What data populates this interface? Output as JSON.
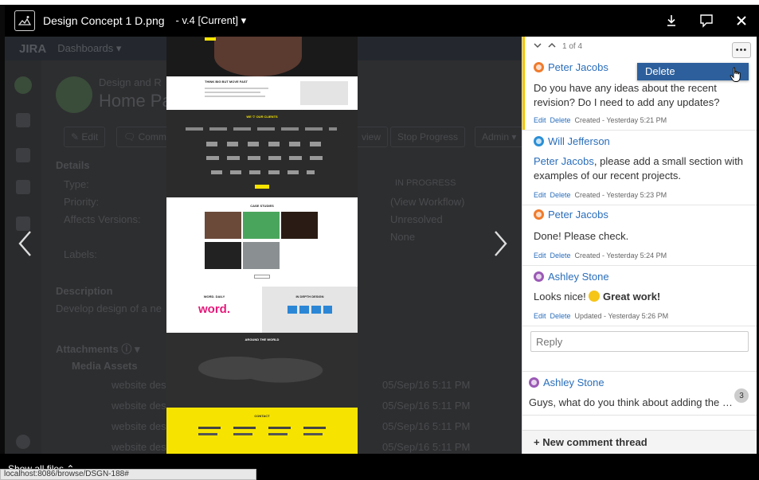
{
  "header": {
    "file_name": "Design Concept 1 D.png",
    "version": "- v.4 [Current] ▾"
  },
  "background": {
    "jira_logo": "JIRA",
    "dashboards": "Dashboards ▾",
    "project": "Design and R",
    "page_title": "Home Pa",
    "edit": "✎ Edit",
    "comment": "🗨 Comm",
    "review": "view",
    "stop_progress": "Stop Progress",
    "admin": "Admin ▾",
    "details": "Details",
    "type": "Type:",
    "priority": "Priority:",
    "affects": "Affects Versions:",
    "labels": "Labels:",
    "status": "IN PROGRESS",
    "workflow": "(View Workflow)",
    "resolution": "Unresolved",
    "fix": "None",
    "description": "Description",
    "description_text": "Develop design of a ne",
    "attachments": "Attachments ⓘ ▾",
    "media": "Media Assets",
    "files": [
      "website desi",
      "website des",
      "website desi",
      "website desi"
    ],
    "dates": [
      "05/Sep/16 5:11 PM",
      "05/Sep/16 5:11 PM",
      "05/Sep/16 5:11 PM",
      "05/Sep/16 5:11 PM"
    ]
  },
  "design": {
    "hero_title": "THINK BIG BUT MOVE FAST",
    "clients": "WE ♡ OUR CLIENTS",
    "case_studies": "CASE STUDIES",
    "word_daily": "WORD. DAILY",
    "word_logo": "word.",
    "in_depth": "IN DEPTH DESIGN",
    "world": "AROUND THE WORLD",
    "contact": "CONTACT"
  },
  "comments_panel": {
    "pager": "1 of 4",
    "dropdown_delete": "Delete",
    "comments": [
      {
        "author": "Peter Jacobs",
        "body": "Do you have any ideas about the recent revision? Do I need to add any updates?",
        "edit": "Edit",
        "delete": "Delete",
        "meta": "Created - Yesterday 5:21 PM"
      },
      {
        "author": "Will Jefferson",
        "mention": "Peter Jacobs",
        "body": ", please add a small section with examples of our recent projects.",
        "edit": "Edit",
        "delete": "Delete",
        "meta": "Created - Yesterday 5:23 PM"
      },
      {
        "author": "Peter Jacobs",
        "body": "Done! Please check.",
        "edit": "Edit",
        "delete": "Delete",
        "meta": "Created - Yesterday 5:24 PM"
      },
      {
        "author": "Ashley Stone",
        "body_prefix": "Looks nice!",
        "body_bold": "Great work!",
        "edit": "Edit",
        "delete": "Delete",
        "meta": "Updated - Yesterday 5:26 PM"
      }
    ],
    "reply_placeholder": "Reply",
    "thread": {
      "author": "Ashley Stone",
      "preview": "Guys, what do you think about adding the second page?",
      "count": "3"
    },
    "new_thread": "+ New comment thread"
  },
  "footer": {
    "show_all_files": "Show all files ⌃",
    "status_url": "localhost:8086/browse/DSGN-188#"
  },
  "colors": {
    "accent_yellow": "#f2c500",
    "link_blue": "#2a6ebb",
    "dropdown_blue": "#2c5f9c"
  }
}
